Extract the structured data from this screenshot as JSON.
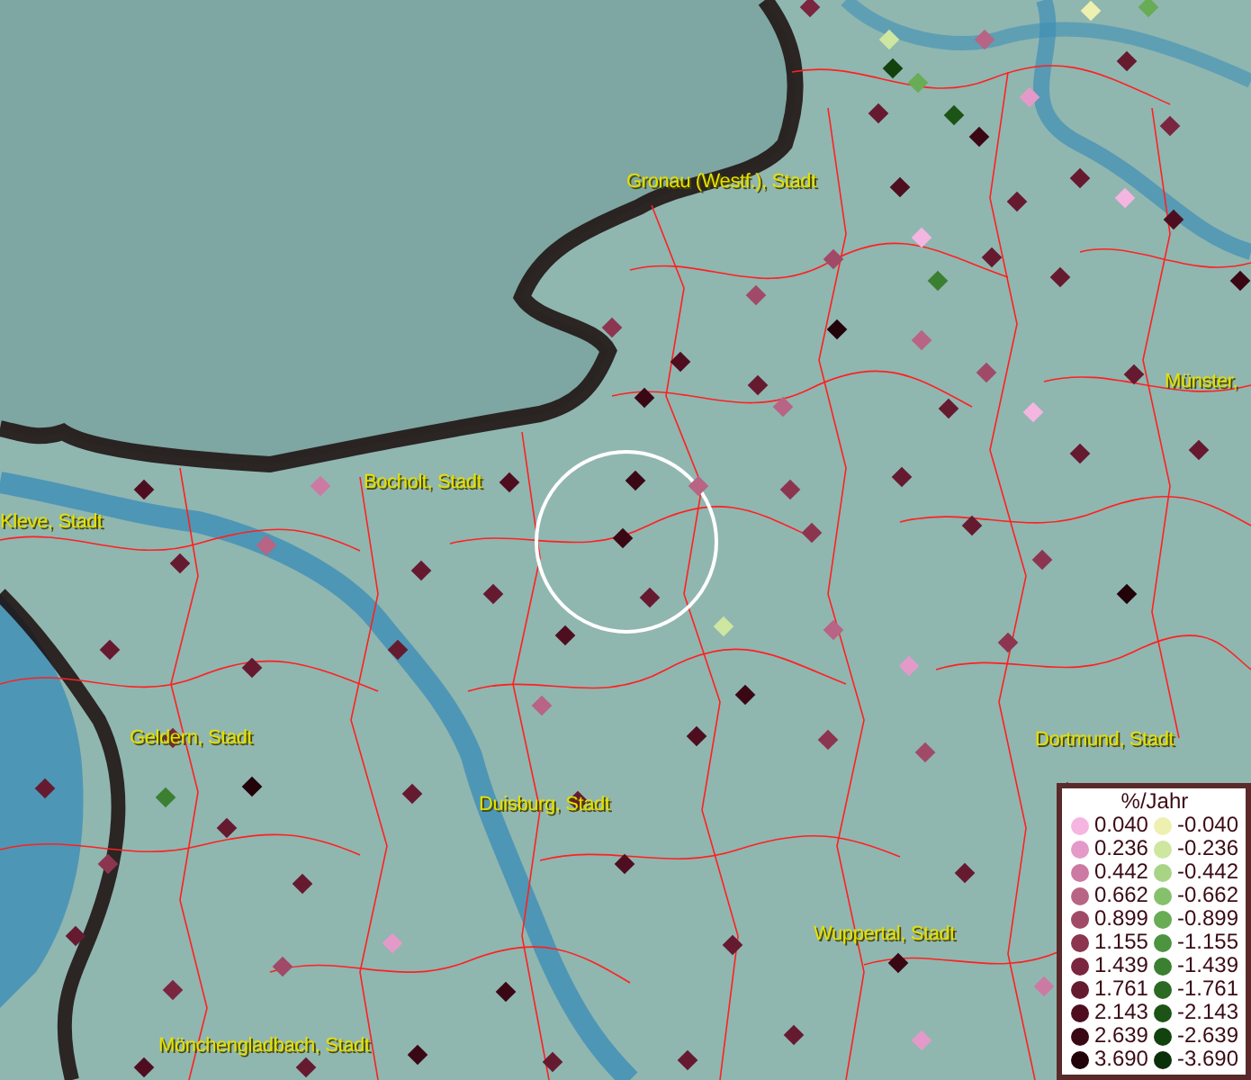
{
  "map": {
    "place_labels": [
      {
        "text": "Gronau (Westf.), Stadt"
      },
      {
        "text": "Münster,"
      },
      {
        "text": "Bocholt, Stadt"
      },
      {
        "text": "Kleve, Stadt"
      },
      {
        "text": "Geldern, Stadt"
      },
      {
        "text": "Duisburg, Stadt"
      },
      {
        "text": "Dortmund, Stadt"
      },
      {
        "text": "Wuppertal, Stadt"
      },
      {
        "text": "Mönchengladbach, Stadt"
      }
    ]
  },
  "legend": {
    "title": "%/Jahr",
    "positive": [
      {
        "value": "0.040",
        "color": "#f4b6e0"
      },
      {
        "value": "0.236",
        "color": "#e49ac8"
      },
      {
        "value": "0.442",
        "color": "#cc7aa4"
      },
      {
        "value": "0.662",
        "color": "#b86484"
      },
      {
        "value": "0.899",
        "color": "#a04a68"
      },
      {
        "value": "1.155",
        "color": "#8c3550"
      },
      {
        "value": "1.439",
        "color": "#7a2640"
      },
      {
        "value": "1.761",
        "color": "#661a30"
      },
      {
        "value": "2.143",
        "color": "#4e0e20"
      },
      {
        "value": "2.639",
        "color": "#3a0814"
      },
      {
        "value": "3.690",
        "color": "#22030a"
      }
    ],
    "negative": [
      {
        "value": "-0.040",
        "color": "#eef0b0"
      },
      {
        "value": "-0.236",
        "color": "#cde6a0"
      },
      {
        "value": "-0.442",
        "color": "#a8d486"
      },
      {
        "value": "-0.662",
        "color": "#86c06c"
      },
      {
        "value": "-0.899",
        "color": "#68ac56"
      },
      {
        "value": "-1.155",
        "color": "#4c9440"
      },
      {
        "value": "-1.439",
        "color": "#3a8030"
      },
      {
        "value": "-1.761",
        "color": "#2a6a22"
      },
      {
        "value": "-2.143",
        "color": "#1c5416"
      },
      {
        "value": "-2.639",
        "color": "#12420e"
      },
      {
        "value": "-3.690",
        "color": "#0a300a"
      }
    ]
  }
}
